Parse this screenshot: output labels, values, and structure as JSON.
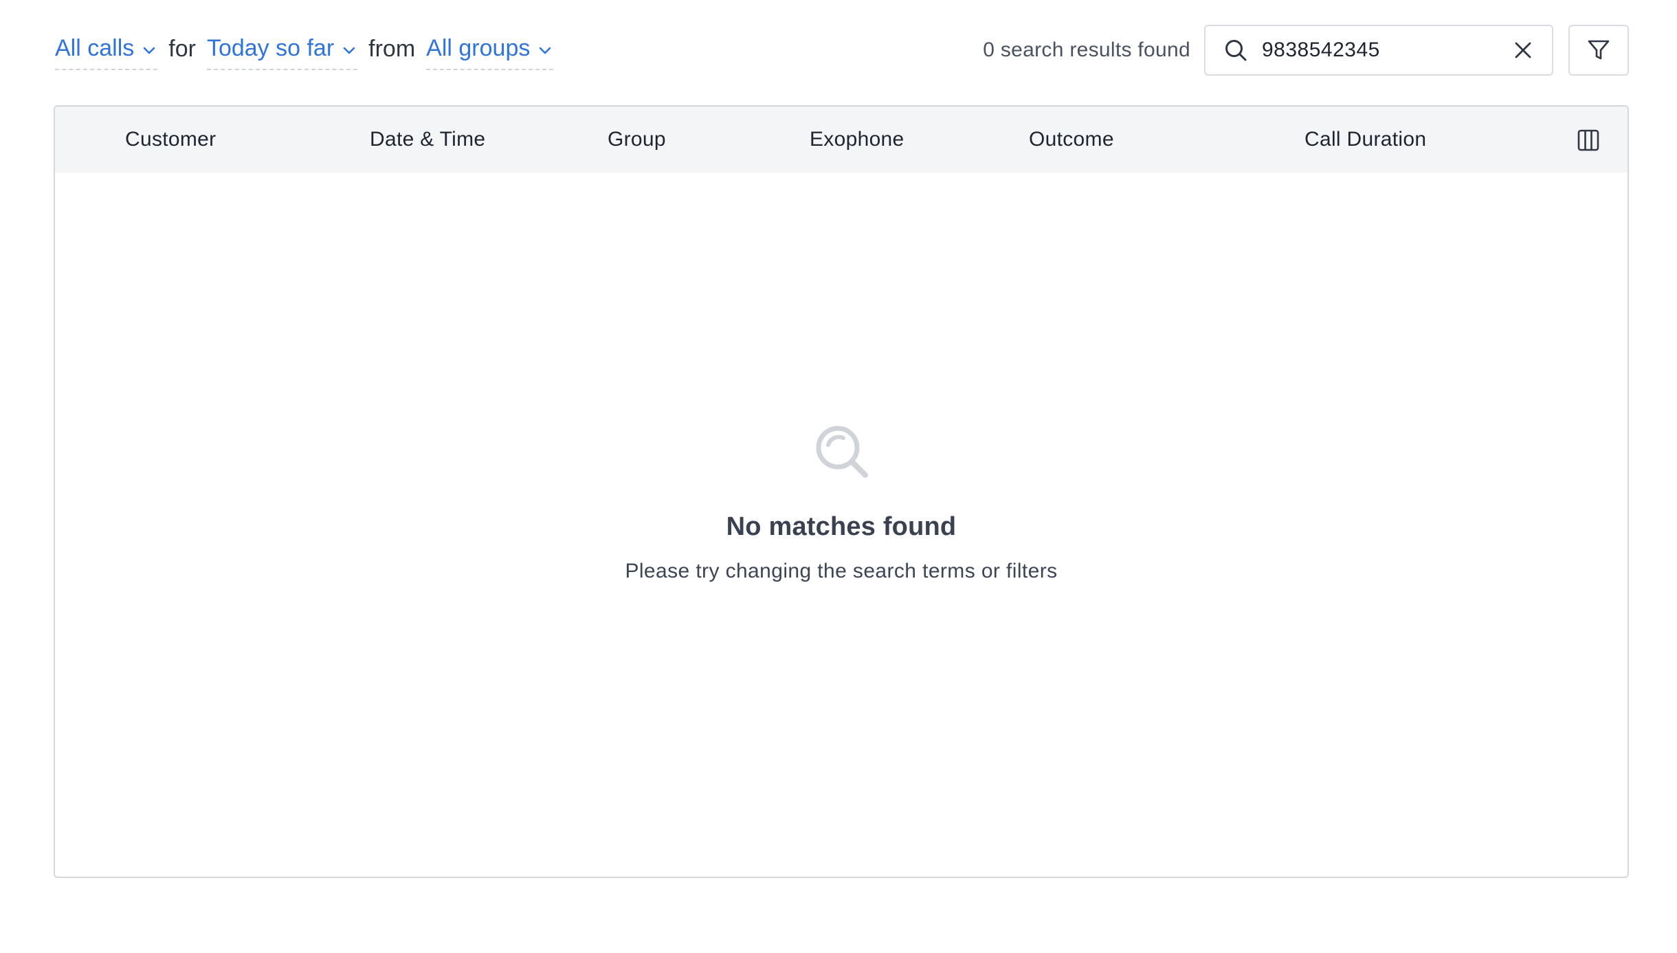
{
  "filters": {
    "call_type": "All calls",
    "for_word": "for",
    "period": "Today so far",
    "from_word": "from",
    "group": "All groups"
  },
  "search": {
    "results_text": "0 search results found",
    "value": "9838542345"
  },
  "icons": {
    "chevron": "chevron-down-icon",
    "search": "search-icon",
    "clear": "close-icon",
    "filter": "filter-funnel-icon",
    "columns": "columns-icon",
    "empty": "magnifier-empty-icon"
  },
  "table": {
    "columns": [
      "Customer",
      "Date & Time",
      "Group",
      "Exophone",
      "Outcome",
      "Call Duration"
    ]
  },
  "empty_state": {
    "title": "No matches found",
    "subtitle": "Please try changing the search terms or filters"
  },
  "colors": {
    "accent": "#2f74dd",
    "header_bg": "#f4f5f6",
    "border": "#d4d8de",
    "empty_icon": "#d0d3d9"
  }
}
